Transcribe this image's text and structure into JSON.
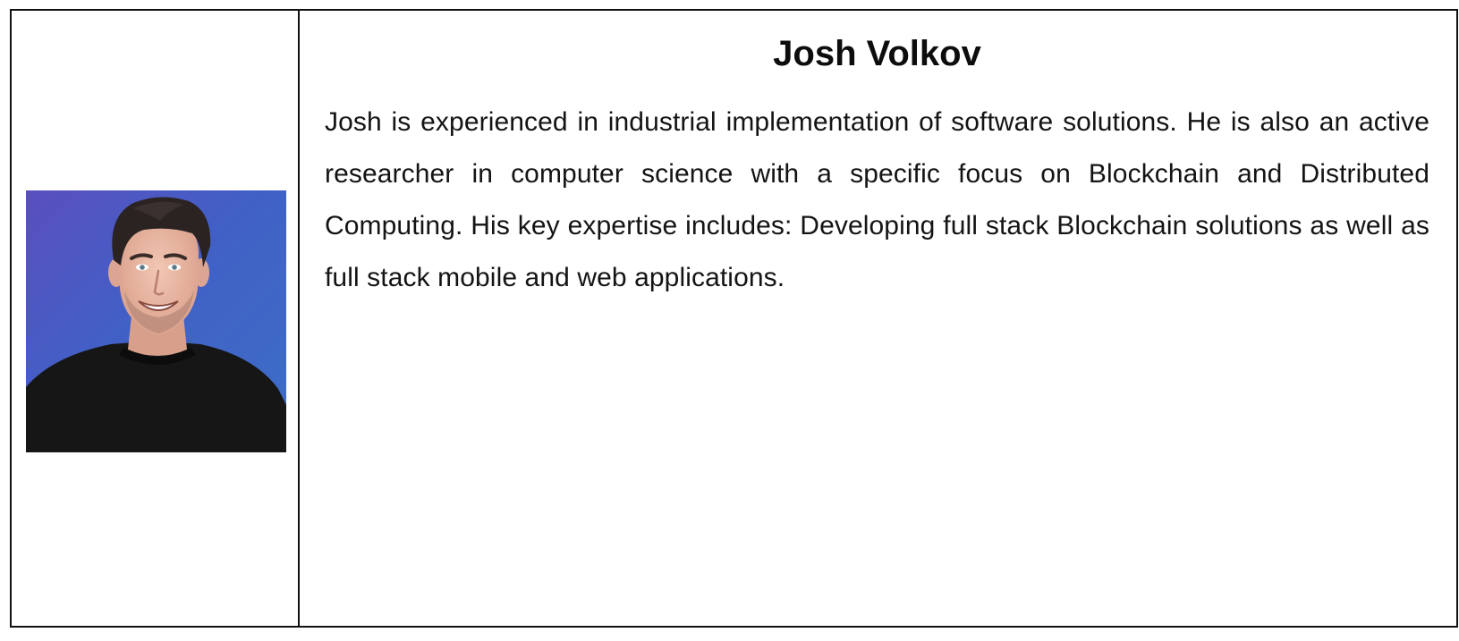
{
  "profile": {
    "name": "Josh Volkov",
    "bio": "Josh is experienced in industrial implementation of software solutions. He is also an active researcher in computer science with a specific focus on Blockchain and Distributed Computing. His key expertise includes: Developing full stack Blockchain solutions as well as full stack mobile and web applications."
  },
  "colors": {
    "border": "#111111",
    "photo_background": "#3f63c4",
    "shirt": "#161616"
  }
}
